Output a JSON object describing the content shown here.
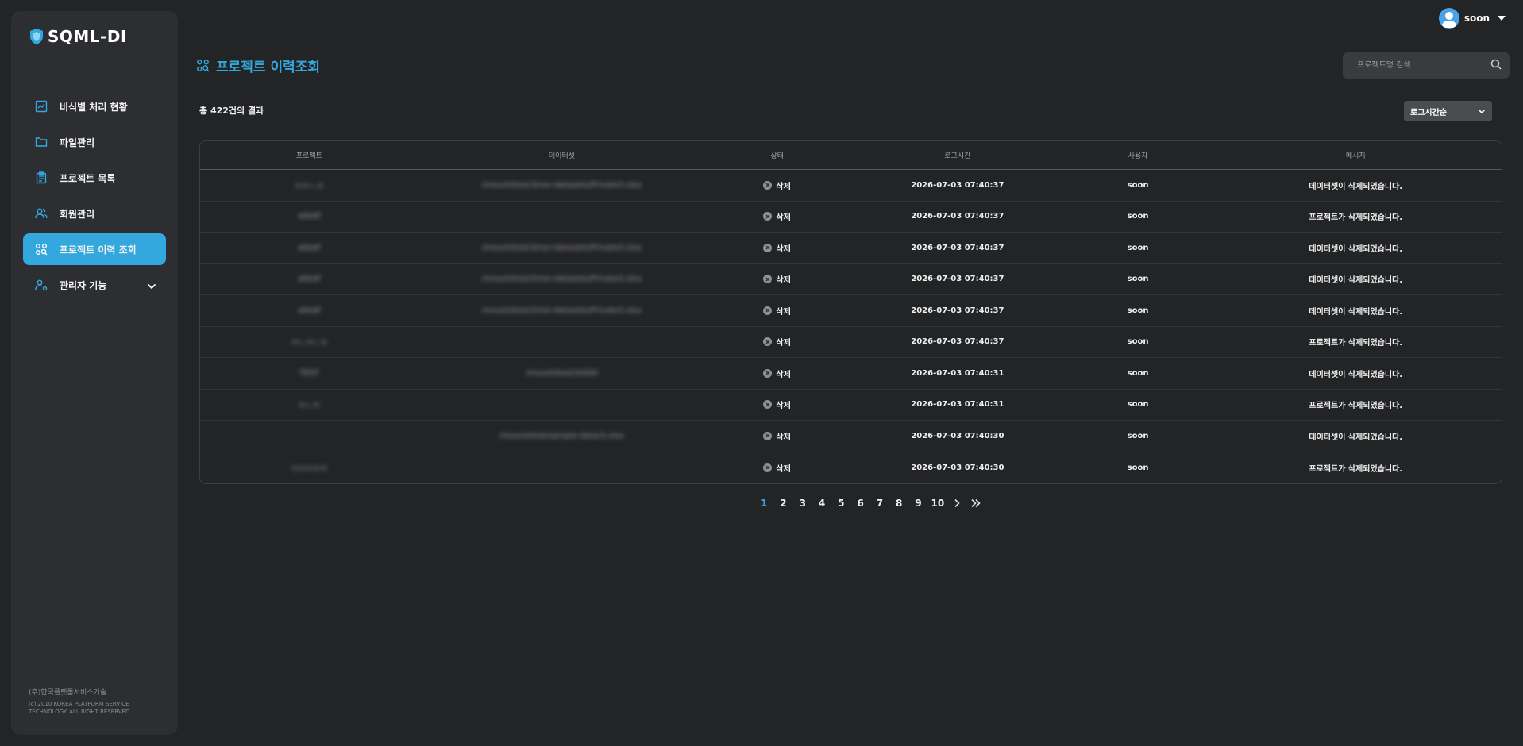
{
  "brand": {
    "logo_text": "SQML-DI"
  },
  "sidebar": {
    "items": [
      {
        "label": "비식별 처리 현황",
        "icon": "chart-icon"
      },
      {
        "label": "파일관리",
        "icon": "folder-icon"
      },
      {
        "label": "프로젝트 목록",
        "icon": "clipboard-icon"
      },
      {
        "label": "회원관리",
        "icon": "users-icon"
      },
      {
        "label": "프로젝트 이력 조회",
        "icon": "history-search-icon",
        "active": true
      },
      {
        "label": "관리자 기능",
        "icon": "admin-icon",
        "expandable": true
      }
    ],
    "copyright_line1": "(주)한국플랫폼서비스기술",
    "copyright_line2": "(c) 2010 KOREA PLATFORM SERVICE TECHNOLOGY. ALL RIGHT RESERVED"
  },
  "header": {
    "username": "soon"
  },
  "page": {
    "title": "프로젝트 이력조회",
    "search_placeholder": "프로젝트명 검색",
    "result_count": "총 422건의 결과",
    "sort_label": "로그시간순"
  },
  "table": {
    "columns": [
      "프로젝트",
      "데이터셋",
      "상태",
      "로그시간",
      "사용자",
      "메시지"
    ],
    "rows": [
      {
        "project": "ㅁㅁㄴㅁ",
        "dataset": "/mount/test/3/ner-datasets/Private3.xlsx",
        "status": "삭제",
        "time": "2026-07-03 07:40:37",
        "user": "soon",
        "message": "데이터셋이 삭제되었습니다."
      },
      {
        "project": "abbdf",
        "dataset": "",
        "status": "삭제",
        "time": "2026-07-03 07:40:37",
        "user": "soon",
        "message": "프로젝트가 삭제되었습니다."
      },
      {
        "project": "abbdf",
        "dataset": "/mount/test/3/ner-datasets/Private3.xlsx",
        "status": "삭제",
        "time": "2026-07-03 07:40:37",
        "user": "soon",
        "message": "데이터셋이 삭제되었습니다."
      },
      {
        "project": "abbdf",
        "dataset": "/mount/test/3/ner-datasets/Private3.xlsx",
        "status": "삭제",
        "time": "2026-07-03 07:40:37",
        "user": "soon",
        "message": "데이터셋이 삭제되었습니다."
      },
      {
        "project": "abbdf",
        "dataset": "/mount/test/3/ner-datasets/Private3.xlsx",
        "status": "삭제",
        "time": "2026-07-03 07:40:37",
        "user": "soon",
        "message": "데이터셋이 삭제되었습니다."
      },
      {
        "project": "ㅁㄴㅁㄴㅁ",
        "dataset": "",
        "status": "삭제",
        "time": "2026-07-03 07:40:37",
        "user": "soon",
        "message": "프로젝트가 삭제되었습니다."
      },
      {
        "project": "TEST",
        "dataset": "/mount/test/3/000",
        "status": "삭제",
        "time": "2026-07-03 07:40:31",
        "user": "soon",
        "message": "데이터셋이 삭제되었습니다."
      },
      {
        "project": "ㅁㄴㅁ",
        "dataset": "",
        "status": "삭제",
        "time": "2026-07-03 07:40:31",
        "user": "soon",
        "message": "프로젝트가 삭제되었습니다."
      },
      {
        "project": "",
        "dataset": "/mount/test/sample-data/3.xlsx",
        "status": "삭제",
        "time": "2026-07-03 07:40:30",
        "user": "soon",
        "message": "데이터셋이 삭제되었습니다."
      },
      {
        "project": "ㅁㅁㅁㅁㅁ",
        "dataset": "",
        "status": "삭제",
        "time": "2026-07-03 07:40:30",
        "user": "soon",
        "message": "프로젝트가 삭제되었습니다."
      }
    ]
  },
  "pagination": {
    "pages": [
      "1",
      "2",
      "3",
      "4",
      "5",
      "6",
      "7",
      "8",
      "9",
      "10"
    ],
    "current": "1"
  },
  "colors": {
    "accent": "#33a8de",
    "background": "#232426",
    "sidebar": "#2d2e32"
  }
}
